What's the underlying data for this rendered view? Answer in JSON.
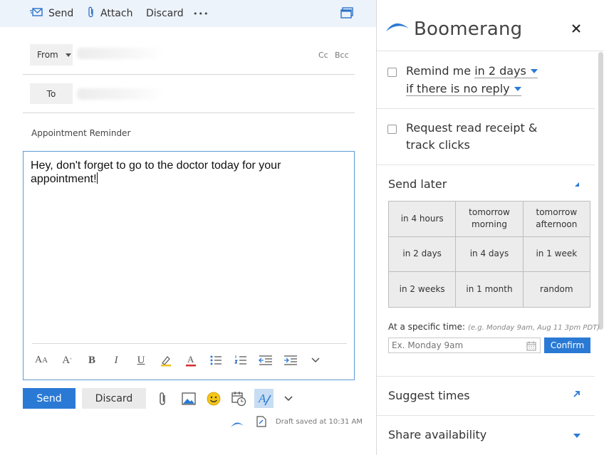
{
  "toolbar": {
    "send_label": "Send",
    "attach_label": "Attach",
    "discard_label": "Discard",
    "more_label": "•••"
  },
  "compose": {
    "from_label": "From",
    "to_label": "To",
    "cc_label": "Cc",
    "bcc_label": "Bcc",
    "subject": "Appointment Reminder",
    "body": "Hey, don't forget to go to the doctor today for your appointment!",
    "send_label": "Send",
    "discard_label": "Discard",
    "draft_status": "Draft saved at 10:31 AM"
  },
  "icons": {
    "send": "send-icon",
    "attach": "paperclip-icon",
    "more": "ellipsis-icon",
    "popout": "popout-icon",
    "format": [
      "font-size-icon",
      "font-grow-icon",
      "bold-icon",
      "italic-icon",
      "underline-icon",
      "highlight-icon",
      "font-color-icon",
      "bullets-icon",
      "numbering-icon",
      "decrease-indent-icon",
      "increase-indent-icon",
      "chevron-down-icon"
    ],
    "bottom": [
      "paperclip-icon",
      "image-icon",
      "emoji-icon",
      "calendar-clock-icon",
      "format-text-icon",
      "chevron-down-icon"
    ]
  },
  "boomerang": {
    "title": "Boomerang",
    "remind": {
      "prefix": "Remind me",
      "interval": "in 2 days",
      "condition": "if there is no reply"
    },
    "receipt_line1": "Request read receipt &",
    "receipt_line2": "track clicks",
    "send_later_label": "Send later",
    "options": [
      [
        "in 4 hours",
        "tomorrow\nmorning",
        "tomorrow\nafternoon"
      ],
      [
        "in 2 days",
        "in 4 days",
        "in 1 week"
      ],
      [
        "in 2 weeks",
        "in 1 month",
        "random"
      ]
    ],
    "specific_time_label": "At a specific time:",
    "specific_time_hint": "(e.g. Monday 9am, Aug 11 3pm PDT)",
    "specific_time_placeholder": "Ex. Monday 9am",
    "confirm_label": "Confirm",
    "suggest_times_label": "Suggest times",
    "share_availability_label": "Share availability"
  },
  "colors": {
    "accent": "#2a7ad5",
    "toolbar_bg": "#edf3fb",
    "grid_cell": "#ececec"
  }
}
